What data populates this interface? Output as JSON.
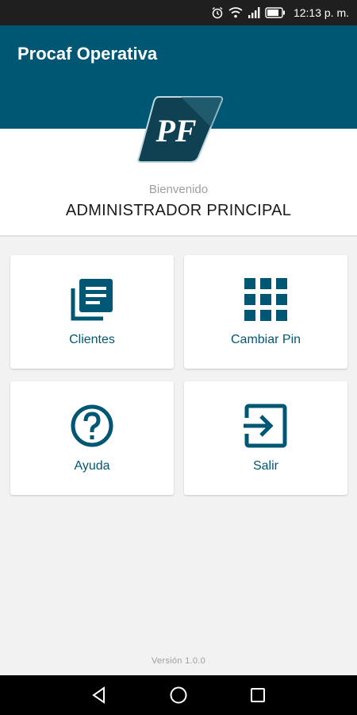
{
  "status_bar": {
    "time": "12:13 p. m.",
    "icons": [
      "alarm-icon",
      "wifi-icon",
      "signal-icon",
      "battery-icon"
    ]
  },
  "app_bar": {
    "title": "Procaf Operativa",
    "color": "#005773"
  },
  "profile": {
    "logo_text": "PF",
    "welcome": "Bienvenido",
    "name": "ADMINISTRADOR PRINCIPAL"
  },
  "menu": [
    {
      "label": "Clientes",
      "icon": "list-icon"
    },
    {
      "label": "Cambiar Pin",
      "icon": "grid-icon"
    },
    {
      "label": "Ayuda",
      "icon": "help-icon"
    },
    {
      "label": "Salir",
      "icon": "exit-icon"
    }
  ],
  "footer": {
    "version": "Versión 1.0.0"
  },
  "nav_bar": {
    "buttons": [
      "back-icon",
      "home-icon",
      "recents-icon"
    ]
  },
  "colors": {
    "primary": "#005773",
    "status_bar": "#1f1f1f",
    "background": "#f2f2f2"
  }
}
